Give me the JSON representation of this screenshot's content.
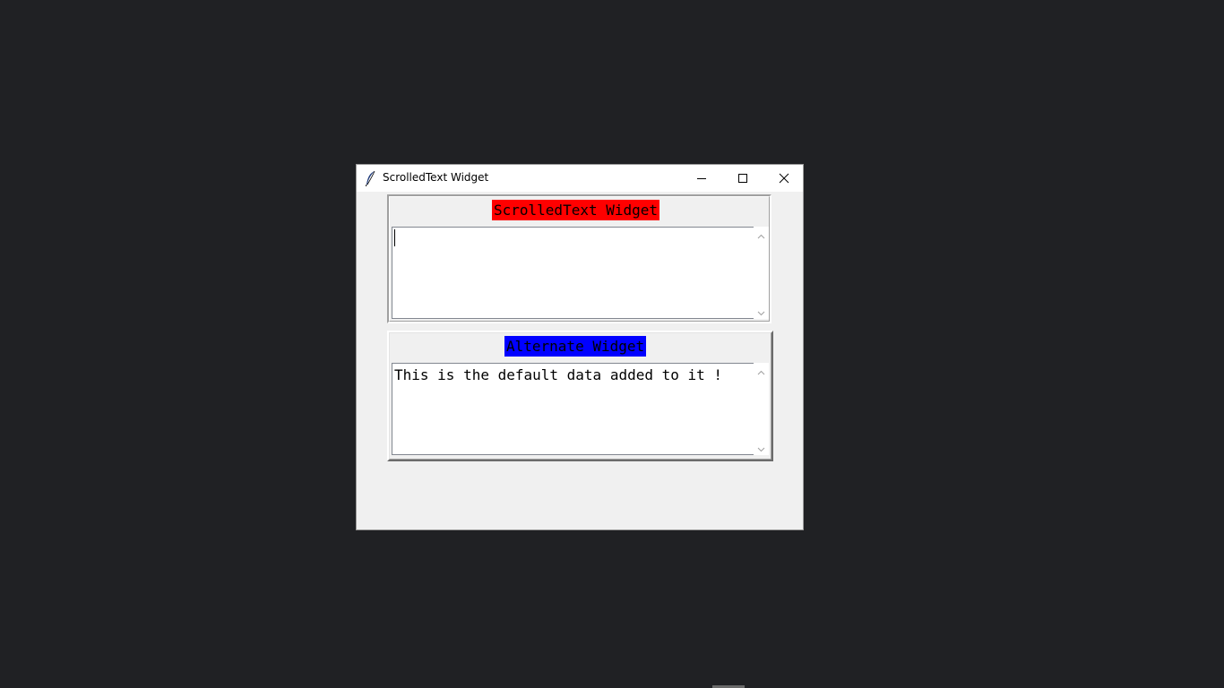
{
  "window": {
    "title": "ScrolledText Widget",
    "icon": "feather-icon",
    "controls": {
      "minimize": "minimize-icon",
      "maximize": "maximize-icon",
      "close": "close-icon"
    }
  },
  "frames": [
    {
      "label": "ScrolledText Widget",
      "label_bg": "#ff0000",
      "text": ""
    },
    {
      "label": "Alternate Widget",
      "label_bg": "#0000ff",
      "text": "This is the default data added to it !"
    }
  ],
  "colors": {
    "desktop": "#202124",
    "window_bg": "#f0f0f0",
    "titlebar_bg": "#ffffff"
  }
}
